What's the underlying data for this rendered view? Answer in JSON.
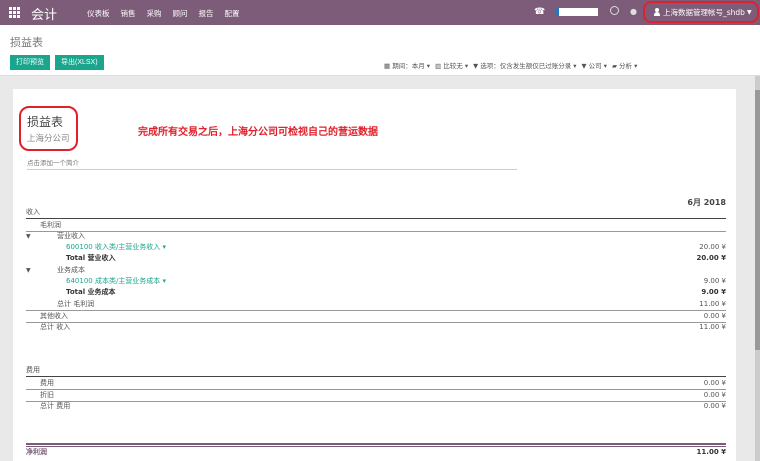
{
  "topbar": {
    "app_title": "会计",
    "menu": [
      "仪表板",
      "销售",
      "采购",
      "顾问",
      "报告",
      "配置"
    ],
    "user_name": "上海数据管理帐号_shdb"
  },
  "control_panel": {
    "breadcrumb": "损益表",
    "print_label": "打印预览",
    "export_label": "导出(XLSX)",
    "filters": [
      "期间：本月 ▾",
      "比较无 ▾",
      "选项：仅含发生额仅已过账分录 ▾",
      "公司 ▾",
      "分析 ▾"
    ]
  },
  "report": {
    "title": "损益表",
    "company": "上海分公司",
    "annotation": "完成所有交易之后，上海分公司可检视自己的营运数据",
    "summary_placeholder": "点击添加一个简介",
    "period": "6月 2018",
    "income": {
      "section": "收入",
      "gross_profit": "毛利润",
      "operating_income": "营业收入",
      "account_income": "600100 收入类/主营业务收入 ▾",
      "account_income_amt": "20.00 ¥",
      "total_operating_income": "Total 营业收入",
      "total_operating_income_amt": "20.00 ¥",
      "cost_of_revenue": "业务成本",
      "account_cost": "640100 成本类/主营业务成本 ▾",
      "account_cost_amt": "9.00 ¥",
      "total_cost": "Total 业务成本",
      "total_cost_amt": "9.00 ¥",
      "total_gross_profit": "总计 毛利润",
      "total_gross_profit_amt": "11.00 ¥",
      "other_income": "其他收入",
      "other_income_amt": "0.00 ¥",
      "total_income": "总计 收入",
      "total_income_amt": "11.00 ¥"
    },
    "expense": {
      "section": "费用",
      "expenses": "费用",
      "expenses_amt": "0.00 ¥",
      "depreciation": "折旧",
      "depreciation_amt": "0.00 ¥",
      "total_expense": "总计 费用",
      "total_expense_amt": "0.00 ¥"
    },
    "net_profit": "净利润",
    "net_profit_amt": "11.00 ¥"
  }
}
